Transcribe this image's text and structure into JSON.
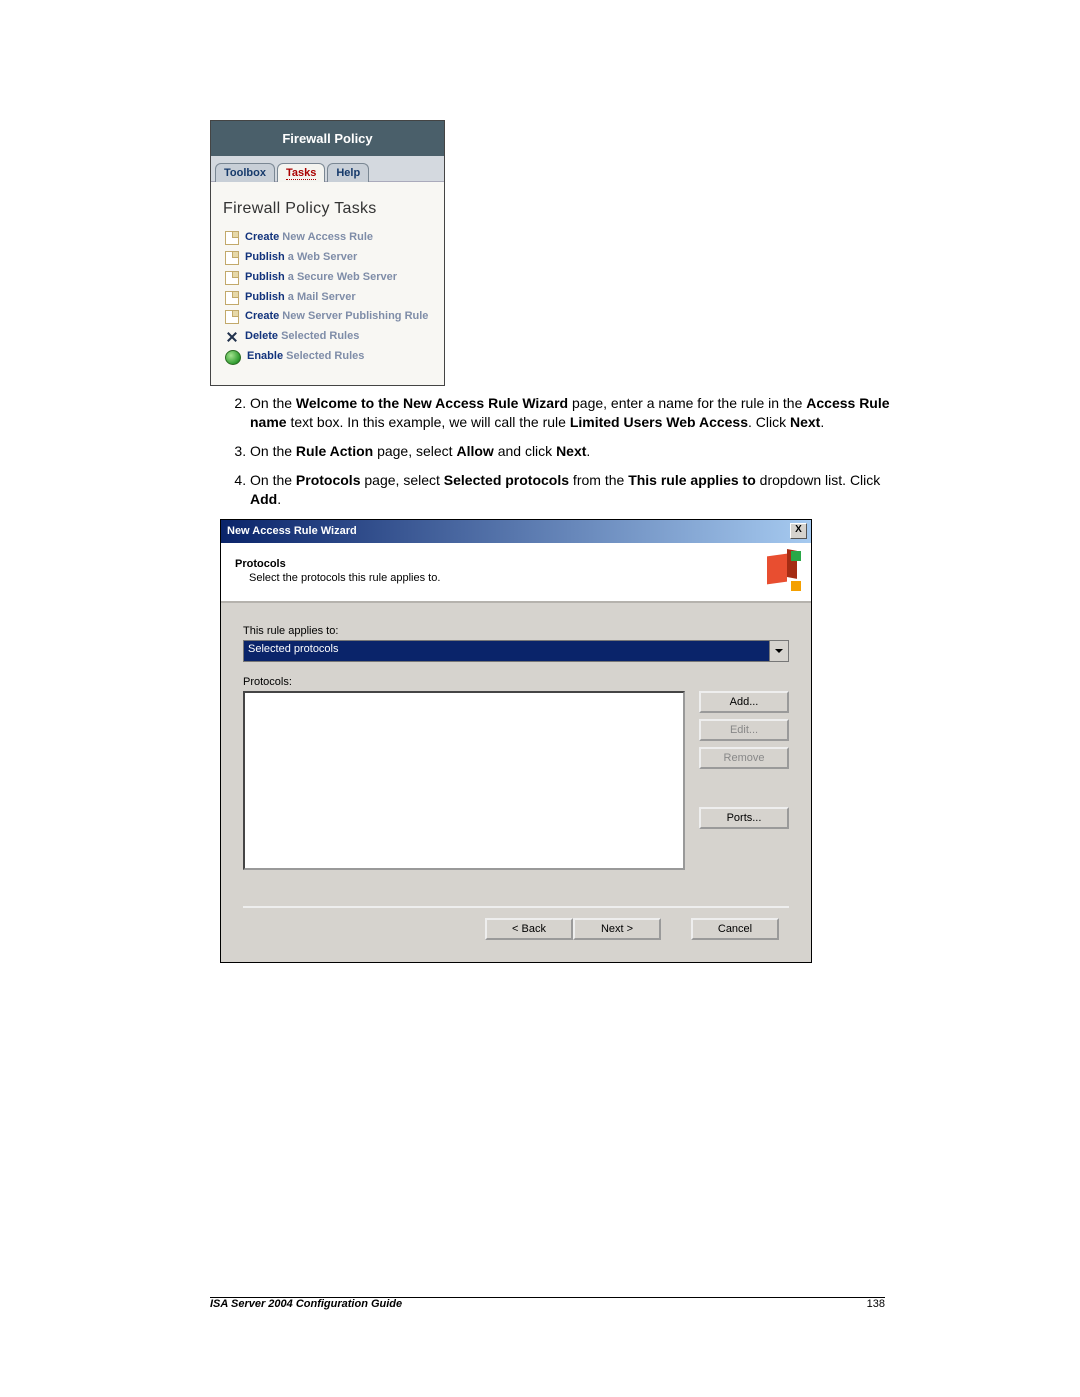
{
  "firewall_panel": {
    "header": "Firewall Policy",
    "tabs": {
      "toolbox": "Toolbox",
      "tasks": "Tasks",
      "help": "Help"
    },
    "heading": "Firewall Policy Tasks",
    "tasks": [
      {
        "bold": "Create",
        "rest": " New Access Rule",
        "icon": "doc"
      },
      {
        "bold": "Publish",
        "rest": " a Web Server",
        "icon": "doc"
      },
      {
        "bold": "Publish",
        "rest": " a Secure Web Server",
        "icon": "doc"
      },
      {
        "bold": "Publish",
        "rest": " a Mail Server",
        "icon": "doc"
      },
      {
        "bold": "Create",
        "rest": " New Server Publishing Rule",
        "icon": "doc"
      },
      {
        "bold": "Delete",
        "rest": " Selected Rules",
        "icon": "x"
      },
      {
        "bold": "Enable",
        "rest": " Selected Rules",
        "icon": "ball"
      }
    ]
  },
  "steps": {
    "s2_a": "On the ",
    "s2_b": "Welcome to the New Access Rule Wizard",
    "s2_c": " page, enter a name for the rule in the ",
    "s2_d": "Access Rule name",
    "s2_e": " text box. In this example, we will call the rule ",
    "s2_f": "Limited Users Web Access",
    "s2_g": ". Click ",
    "s2_h": "Next",
    "s2_i": ".",
    "s3_a": "On the ",
    "s3_b": "Rule Action",
    "s3_c": " page, select ",
    "s3_d": "Allow",
    "s3_e": " and click ",
    "s3_f": "Next",
    "s3_g": ".",
    "s4_a": "On the ",
    "s4_b": "Protocols",
    "s4_c": " page, select ",
    "s4_d": "Selected protocols",
    "s4_e": " from the ",
    "s4_f": "This rule applies to",
    "s4_g": " dropdown list. Click ",
    "s4_h": "Add",
    "s4_i": "."
  },
  "wizard": {
    "title": "New Access Rule Wizard",
    "header_title": "Protocols",
    "header_sub": "Select the protocols this rule applies to.",
    "applies_label": "This rule applies to:",
    "combo_value": "Selected protocols",
    "protocols_label": "Protocols:",
    "btn_add": "Add...",
    "btn_edit": "Edit...",
    "btn_remove": "Remove",
    "btn_ports": "Ports...",
    "btn_back": "< Back",
    "btn_next": "Next >",
    "btn_cancel": "Cancel",
    "close_x": "X"
  },
  "footer": {
    "title": "ISA Server 2004 Configuration Guide",
    "page": "138"
  }
}
